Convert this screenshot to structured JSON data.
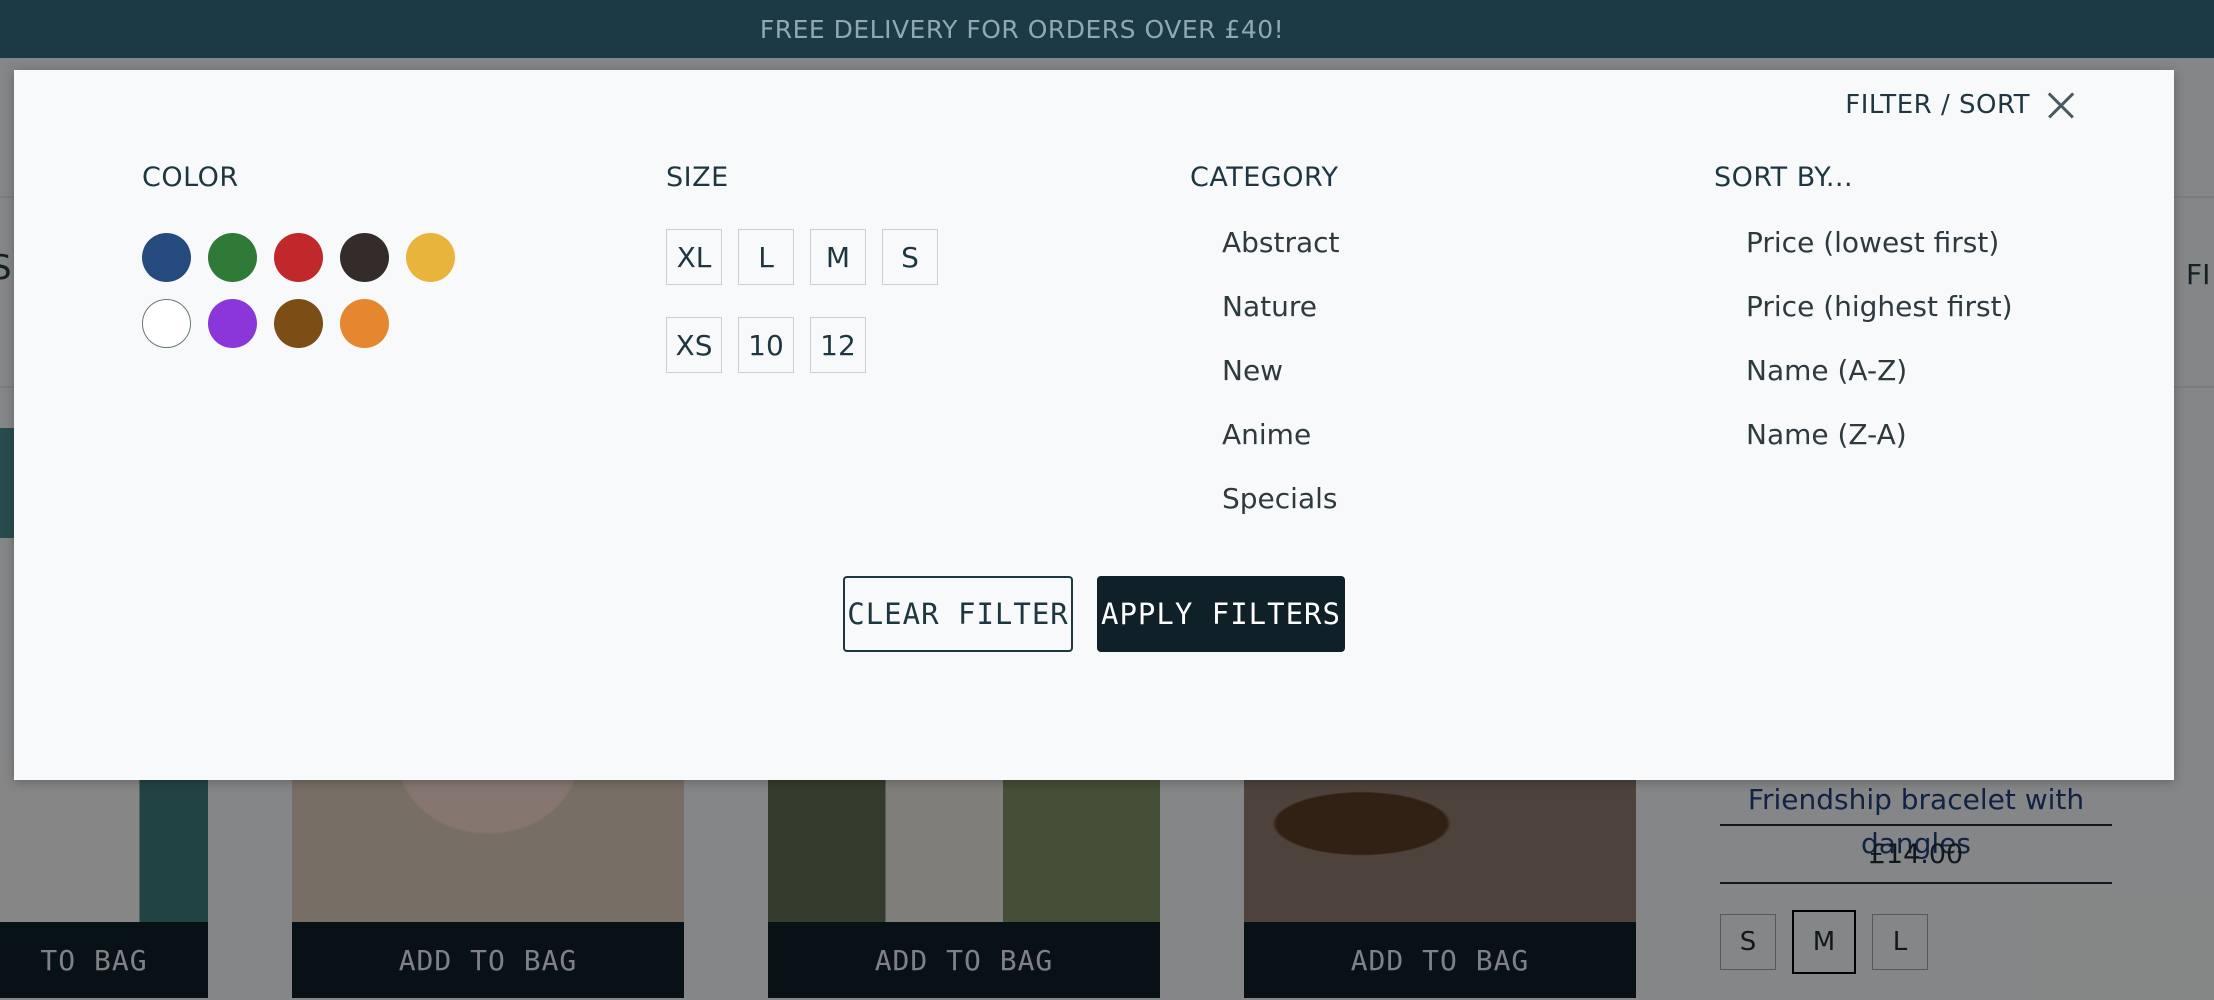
{
  "promo": {
    "text": "FREE DELIVERY FOR ORDERS OVER £40!"
  },
  "background_page": {
    "left_edge_text": "S:",
    "right_edge_text": "FI",
    "cards": [
      {
        "button": "TO BAG"
      },
      {
        "button": "ADD TO BAG"
      },
      {
        "button": "ADD TO BAG"
      },
      {
        "button": "ADD TO BAG"
      }
    ],
    "product": {
      "name": "Friendship bracelet with dangles",
      "price": "£14.00",
      "sizes": [
        "S",
        "M",
        "L"
      ],
      "selected_size": "M"
    }
  },
  "modal": {
    "title": "FILTER / SORT",
    "close_icon": "close-icon",
    "color": {
      "title": "COLOR",
      "swatches": [
        {
          "name": "blue",
          "hex": "#244a7e"
        },
        {
          "name": "green",
          "hex": "#2f7a36"
        },
        {
          "name": "red",
          "hex": "#c0282c"
        },
        {
          "name": "black",
          "hex": "#332c2a"
        },
        {
          "name": "yellow",
          "hex": "#e8b43c"
        },
        {
          "name": "white",
          "hex": "#ffffff"
        },
        {
          "name": "purple",
          "hex": "#8a36d9"
        },
        {
          "name": "brown",
          "hex": "#7a4e14"
        },
        {
          "name": "orange",
          "hex": "#e6862e"
        }
      ]
    },
    "size": {
      "title": "SIZE",
      "options": [
        "XL",
        "L",
        "M",
        "S",
        "XS",
        "10",
        "12"
      ]
    },
    "category": {
      "title": "CATEGORY",
      "options": [
        "Abstract",
        "Nature",
        "New",
        "Anime",
        "Specials"
      ]
    },
    "sort": {
      "title": "SORT BY...",
      "options": [
        "Price (lowest first)",
        "Price (highest first)",
        "Name (A-Z)",
        "Name (Z-A)"
      ]
    },
    "buttons": {
      "clear": "CLEAR FILTER",
      "apply": "APPLY FILTERS"
    }
  }
}
